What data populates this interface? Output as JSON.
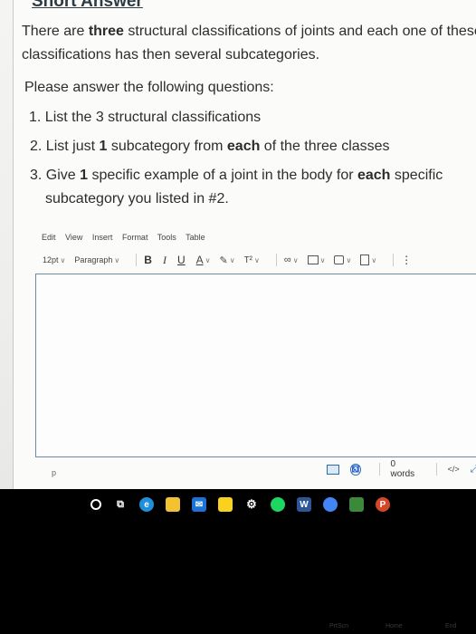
{
  "section": {
    "title": "Short Answer"
  },
  "question": {
    "intro_line1": "There are three structural classifications of joints and each one of these",
    "intro_line2": "classifications has then several subcategories.",
    "please": "Please answer the following questions:",
    "items": [
      "1. List the 3 structural classifications",
      "2. List just 1 subcategory from each of the three classes",
      "3. Give 1 specific example of a joint in the body for each specific",
      "subcategory you listed in #2."
    ]
  },
  "editor": {
    "menu": [
      "Edit",
      "View",
      "Insert",
      "Format",
      "Tools",
      "Table"
    ],
    "toolbar": {
      "font_size": "12pt",
      "block_format": "Paragraph",
      "bold": "B",
      "italic": "I",
      "underline": "U",
      "text_color": "A",
      "superscript": "T²",
      "more": "⋮"
    },
    "status": {
      "path": "p",
      "word_count": "0 words",
      "html_toggle": "</>"
    }
  },
  "taskbar": {
    "icons": [
      "start-icon",
      "task-view-icon",
      "edge-icon",
      "file-explorer-icon",
      "mail-icon",
      "sticky-notes-icon",
      "settings-icon",
      "spotify-icon",
      "word-icon",
      "chrome-icon",
      "calculator-icon",
      "powerpoint-icon"
    ]
  },
  "keyboard": {
    "keys": [
      "PrtScn",
      "Home",
      "End"
    ]
  }
}
